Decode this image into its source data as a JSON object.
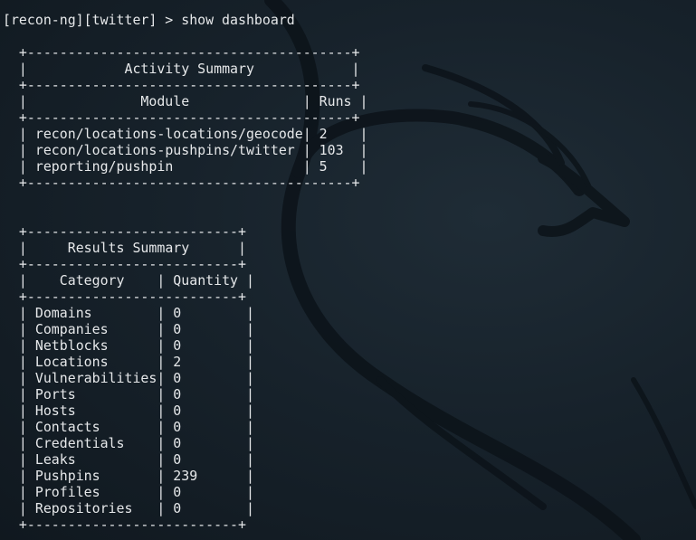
{
  "prompt": "[recon-ng][twitter] >",
  "command": "show dashboard",
  "activity_summary": {
    "title": "Activity Summary",
    "columns": [
      "Module",
      "Runs"
    ],
    "rows": [
      {
        "module": "recon/locations-locations/geocode",
        "runs": "2"
      },
      {
        "module": "recon/locations-pushpins/twitter",
        "runs": "103"
      },
      {
        "module": "reporting/pushpin",
        "runs": "5"
      }
    ]
  },
  "results_summary": {
    "title": "Results Summary",
    "columns": [
      "Category",
      "Quantity"
    ],
    "rows": [
      {
        "category": "Domains",
        "quantity": "0"
      },
      {
        "category": "Companies",
        "quantity": "0"
      },
      {
        "category": "Netblocks",
        "quantity": "0"
      },
      {
        "category": "Locations",
        "quantity": "2"
      },
      {
        "category": "Vulnerabilities",
        "quantity": "0"
      },
      {
        "category": "Ports",
        "quantity": "0"
      },
      {
        "category": "Hosts",
        "quantity": "0"
      },
      {
        "category": "Contacts",
        "quantity": "0"
      },
      {
        "category": "Credentials",
        "quantity": "0"
      },
      {
        "category": "Leaks",
        "quantity": "0"
      },
      {
        "category": "Pushpins",
        "quantity": "239"
      },
      {
        "category": "Profiles",
        "quantity": "0"
      },
      {
        "category": "Repositories",
        "quantity": "0"
      }
    ]
  },
  "background": {
    "logo": "kali-dragon-watermark",
    "colors": {
      "bg_dark": "#10181f",
      "bg_mid": "#1f2c36",
      "dragon": "#0d141a",
      "text": "#e6e8ea"
    }
  }
}
